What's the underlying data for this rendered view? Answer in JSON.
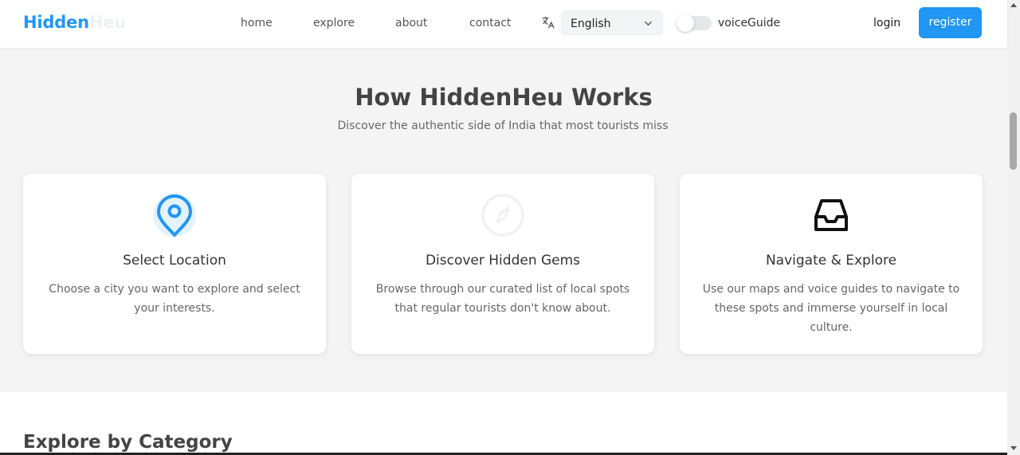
{
  "brand": {
    "part1": "Hidden",
    "part2": "Heu"
  },
  "nav": {
    "home": "home",
    "explore": "explore",
    "about": "about",
    "contact": "contact"
  },
  "language": {
    "icon": "translate-icon",
    "selected": "English"
  },
  "voice_guide": {
    "label": "voiceGuide",
    "enabled": false
  },
  "auth": {
    "login": "login",
    "register": "register"
  },
  "how_it_works": {
    "title": "How HiddenHeu Works",
    "subtitle": "Discover the authentic side of India that most tourists miss",
    "cards": [
      {
        "icon": "map-pin-icon",
        "title": "Select Location",
        "description": "Choose a city you want to explore and select your interests."
      },
      {
        "icon": "compass-icon",
        "title": "Discover Hidden Gems",
        "description": "Browse through our curated list of local spots that regular tourists don't know about."
      },
      {
        "icon": "inbox-icon",
        "title": "Navigate & Explore",
        "description": "Use our maps and voice guides to navigate to these spots and immerse yourself in local culture."
      }
    ]
  },
  "explore_by_category": {
    "title": "Explore by Category"
  },
  "colors": {
    "accent": "#2196f3",
    "section_bg": "#f4f4f4"
  }
}
